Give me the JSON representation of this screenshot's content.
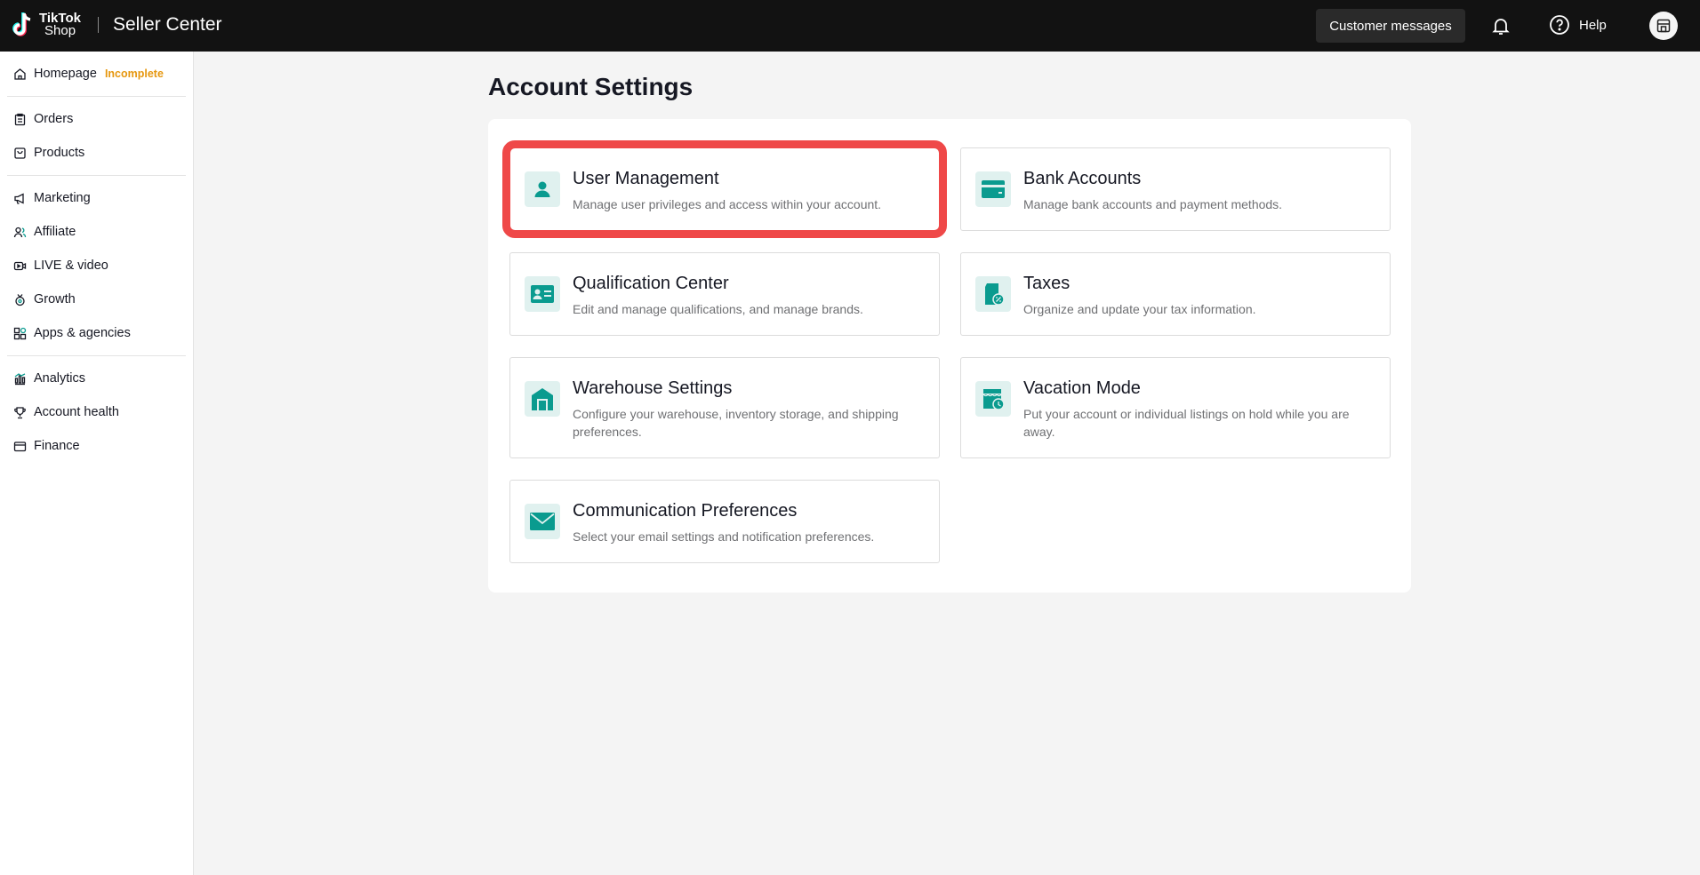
{
  "header": {
    "logo_line1": "TikTok",
    "logo_line2": "Shop",
    "product_name": "Seller Center",
    "customer_messages": "Customer messages",
    "help": "Help"
  },
  "sidebar": {
    "homepage": {
      "label": "Homepage",
      "badge": "Incomplete"
    },
    "orders": "Orders",
    "products": "Products",
    "marketing": "Marketing",
    "affiliate": "Affiliate",
    "live_video": "LIVE & video",
    "growth": "Growth",
    "apps": "Apps & agencies",
    "analytics": "Analytics",
    "account_health": "Account health",
    "finance": "Finance"
  },
  "main": {
    "title": "Account Settings",
    "cards": [
      {
        "title": "User Management",
        "desc": "Manage user privileges and access within your account.",
        "icon": "user-icon"
      },
      {
        "title": "Bank Accounts",
        "desc": "Manage bank accounts and payment methods.",
        "icon": "bank-card-icon"
      },
      {
        "title": "Qualification Center",
        "desc": "Edit and manage qualifications, and manage brands.",
        "icon": "id-card-icon"
      },
      {
        "title": "Taxes",
        "desc": "Organize and update your tax information.",
        "icon": "tax-document-icon"
      },
      {
        "title": "Warehouse Settings",
        "desc": "Configure your warehouse, inventory storage, and shipping preferences.",
        "icon": "warehouse-icon"
      },
      {
        "title": "Vacation Mode",
        "desc": "Put your account or individual listings on hold while you are away.",
        "icon": "vacation-store-icon"
      },
      {
        "title": "Communication Preferences",
        "desc": "Select your email settings and notification preferences.",
        "icon": "envelope-icon"
      }
    ]
  },
  "colors": {
    "accent": "#0a9b8f",
    "icon_bg": "#e0f1ef",
    "highlight": "#ef4848",
    "badge": "#e6970f",
    "topbar": "#121212"
  }
}
